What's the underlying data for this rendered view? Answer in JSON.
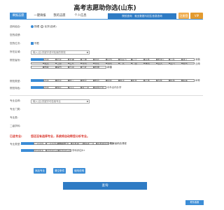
{
  "title": "高考志愿助你选(山东)",
  "nav": {
    "tabs": [
      "填报志愿",
      "一键填报",
      "我的志愿",
      "个人信息"
    ],
    "promo": "院校查询　就业数据与招生信息查询",
    "btn_login": "注册登录",
    "btn_vip": "VIP"
  },
  "form": {
    "rows": [
      {
        "label": "选科组合:",
        "options": [
          "物理",
          "化学(选考)"
        ],
        "selected": 0
      },
      {
        "label": "您的成绩:",
        "value": ""
      },
      {
        "label": "您的位次:",
        "value": "不限"
      },
      {
        "label": "所在区域:",
        "placeholder": "输入(且)关键字或可检索的院校"
      },
      {
        "label": "院校省份:",
        "provinces": [
          "不限",
          "北京",
          "天津",
          "上海",
          "河北",
          "山西",
          "内蒙古",
          "辽宁",
          "吉林",
          "黑龙江",
          "江苏",
          "浙江",
          "安徽",
          "福建",
          "江西",
          "山东",
          "河南",
          "湖北",
          "湖南",
          "广东",
          "广西",
          "海南",
          "重庆",
          "四川",
          "贵州",
          "云南",
          "西藏",
          "陕西",
          "甘肃",
          "宁夏",
          "青海",
          "新疆"
        ]
      },
      {
        "label": "院校类型:",
        "types": [
          "不限",
          "综合",
          "理工",
          "师范",
          "医药",
          "财经",
          "政法",
          "语言",
          "艺术",
          "农林",
          "民族",
          "军事",
          "体育"
        ]
      },
      {
        "label": "院校特色:",
        "features": [
          "不限",
          "985",
          "211",
          "双一流",
          "强基计划",
          "中外合作办学"
        ]
      },
      {
        "label": "办学性质:",
        "nature": [
          "一流大学",
          "一流学科建设高校",
          "部分可查询",
          "双高计划",
          "普通本科一流..."
        ]
      },
      {
        "label": "专业名称:",
        "placeholder": "输入(且)关键字可检索专业"
      }
    ],
    "blanks": [
      "专业门类:",
      "专业类:",
      "二级学科:"
    ],
    "warning": "您还没有选择专业，系统将自动帮您分析专业。",
    "major_types": [
      "一流学科",
      "一流学科建设高校",
      "双万计划",
      "国家级一流",
      "省级一流",
      "国家级特色专业",
      "国家级精品课程"
    ],
    "major_types2": [
      "全国排名",
      "学科评估A+",
      "学科评估A",
      "学科评估B+"
    ],
    "action_buttons": [
      "添加专业",
      "清空条件",
      "使用说明"
    ],
    "submit": "查询",
    "corner": "联系客服"
  }
}
